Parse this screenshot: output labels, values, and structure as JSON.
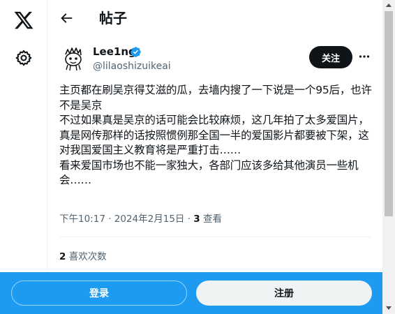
{
  "header": {
    "title": "帖子"
  },
  "author": {
    "display_name": "Lee1ng",
    "handle": "@lilaoshizuikeai",
    "follow_label": "关注"
  },
  "tweet": {
    "text": "主页都在刷吴京得艾滋的瓜，去墙内搜了一下说是一个95后，也许不是吴京\n不过如果真是吴京的话可能会比较麻烦，这几年拍了太多爱国片，真是网传那样的话按照惯例那全国一半的爱国影片都要被下架，这对我国爱国主义教育将是严重打击……\n看来爱国市场也不能一家独大，各部门应该多给其他演员一些机会……",
    "time": "下午10:17",
    "date": "2024年2月15日",
    "views_count": "3",
    "views_label": "查看",
    "likes_count": "2",
    "likes_label": "喜欢次数"
  },
  "bottom_bar": {
    "login_label": "登录",
    "signup_label": "注册"
  },
  "icons": {
    "logo": "x-logo-icon",
    "settings": "gear-icon",
    "back": "back-arrow-icon",
    "verified": "verified-badge-icon",
    "more": "more-horizontal-icon"
  },
  "colors": {
    "accent": "#1d9bf0",
    "text": "#0f1419",
    "secondary_text": "#536471",
    "follow_button_bg": "#0f1419"
  }
}
